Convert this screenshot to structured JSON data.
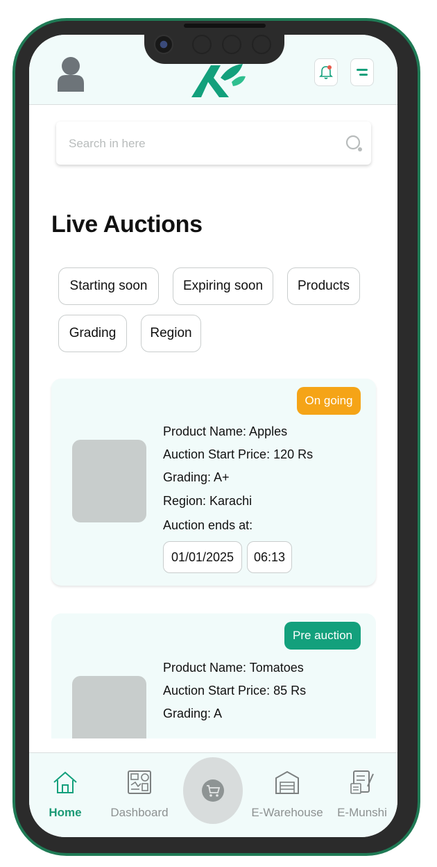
{
  "search": {
    "placeholder": "Search in here"
  },
  "page_title": "Live Auctions",
  "filters": [
    {
      "label": "Starting soon"
    },
    {
      "label": "Expiring soon"
    },
    {
      "label": "Products"
    },
    {
      "label": "Grading"
    },
    {
      "label": "Region"
    }
  ],
  "auctions": [
    {
      "status": "On going",
      "status_color": "#f5a417",
      "product_name": "Product Name: Apples",
      "start_price": "Auction Start Price: 120 Rs",
      "grading": "Grading: A+",
      "region": "Region: Karachi",
      "ends_label": "Auction ends at:",
      "end_date": "01/01/2025",
      "end_time": "06:13"
    },
    {
      "status": "Pre auction",
      "status_color": "#13a07c",
      "product_name": "Product Name: Tomatoes",
      "start_price": "Auction Start Price: 85 Rs",
      "grading": "Grading: A"
    }
  ],
  "nav": {
    "items": [
      {
        "label": "Home",
        "icon": "home-icon",
        "active": true
      },
      {
        "label": "Dashboard",
        "icon": "dashboard-icon",
        "active": false
      },
      {
        "label": "",
        "icon": "cart-icon",
        "active": false
      },
      {
        "label": "E-Warehouse",
        "icon": "warehouse-icon",
        "active": false
      },
      {
        "label": "E-Munshi",
        "icon": "ledger-icon",
        "active": false
      }
    ]
  },
  "colors": {
    "brand_green": "#13a07c",
    "header_bg": "#f1fbfa",
    "ongoing_badge": "#f5a417",
    "preauction_badge": "#13a07c"
  }
}
